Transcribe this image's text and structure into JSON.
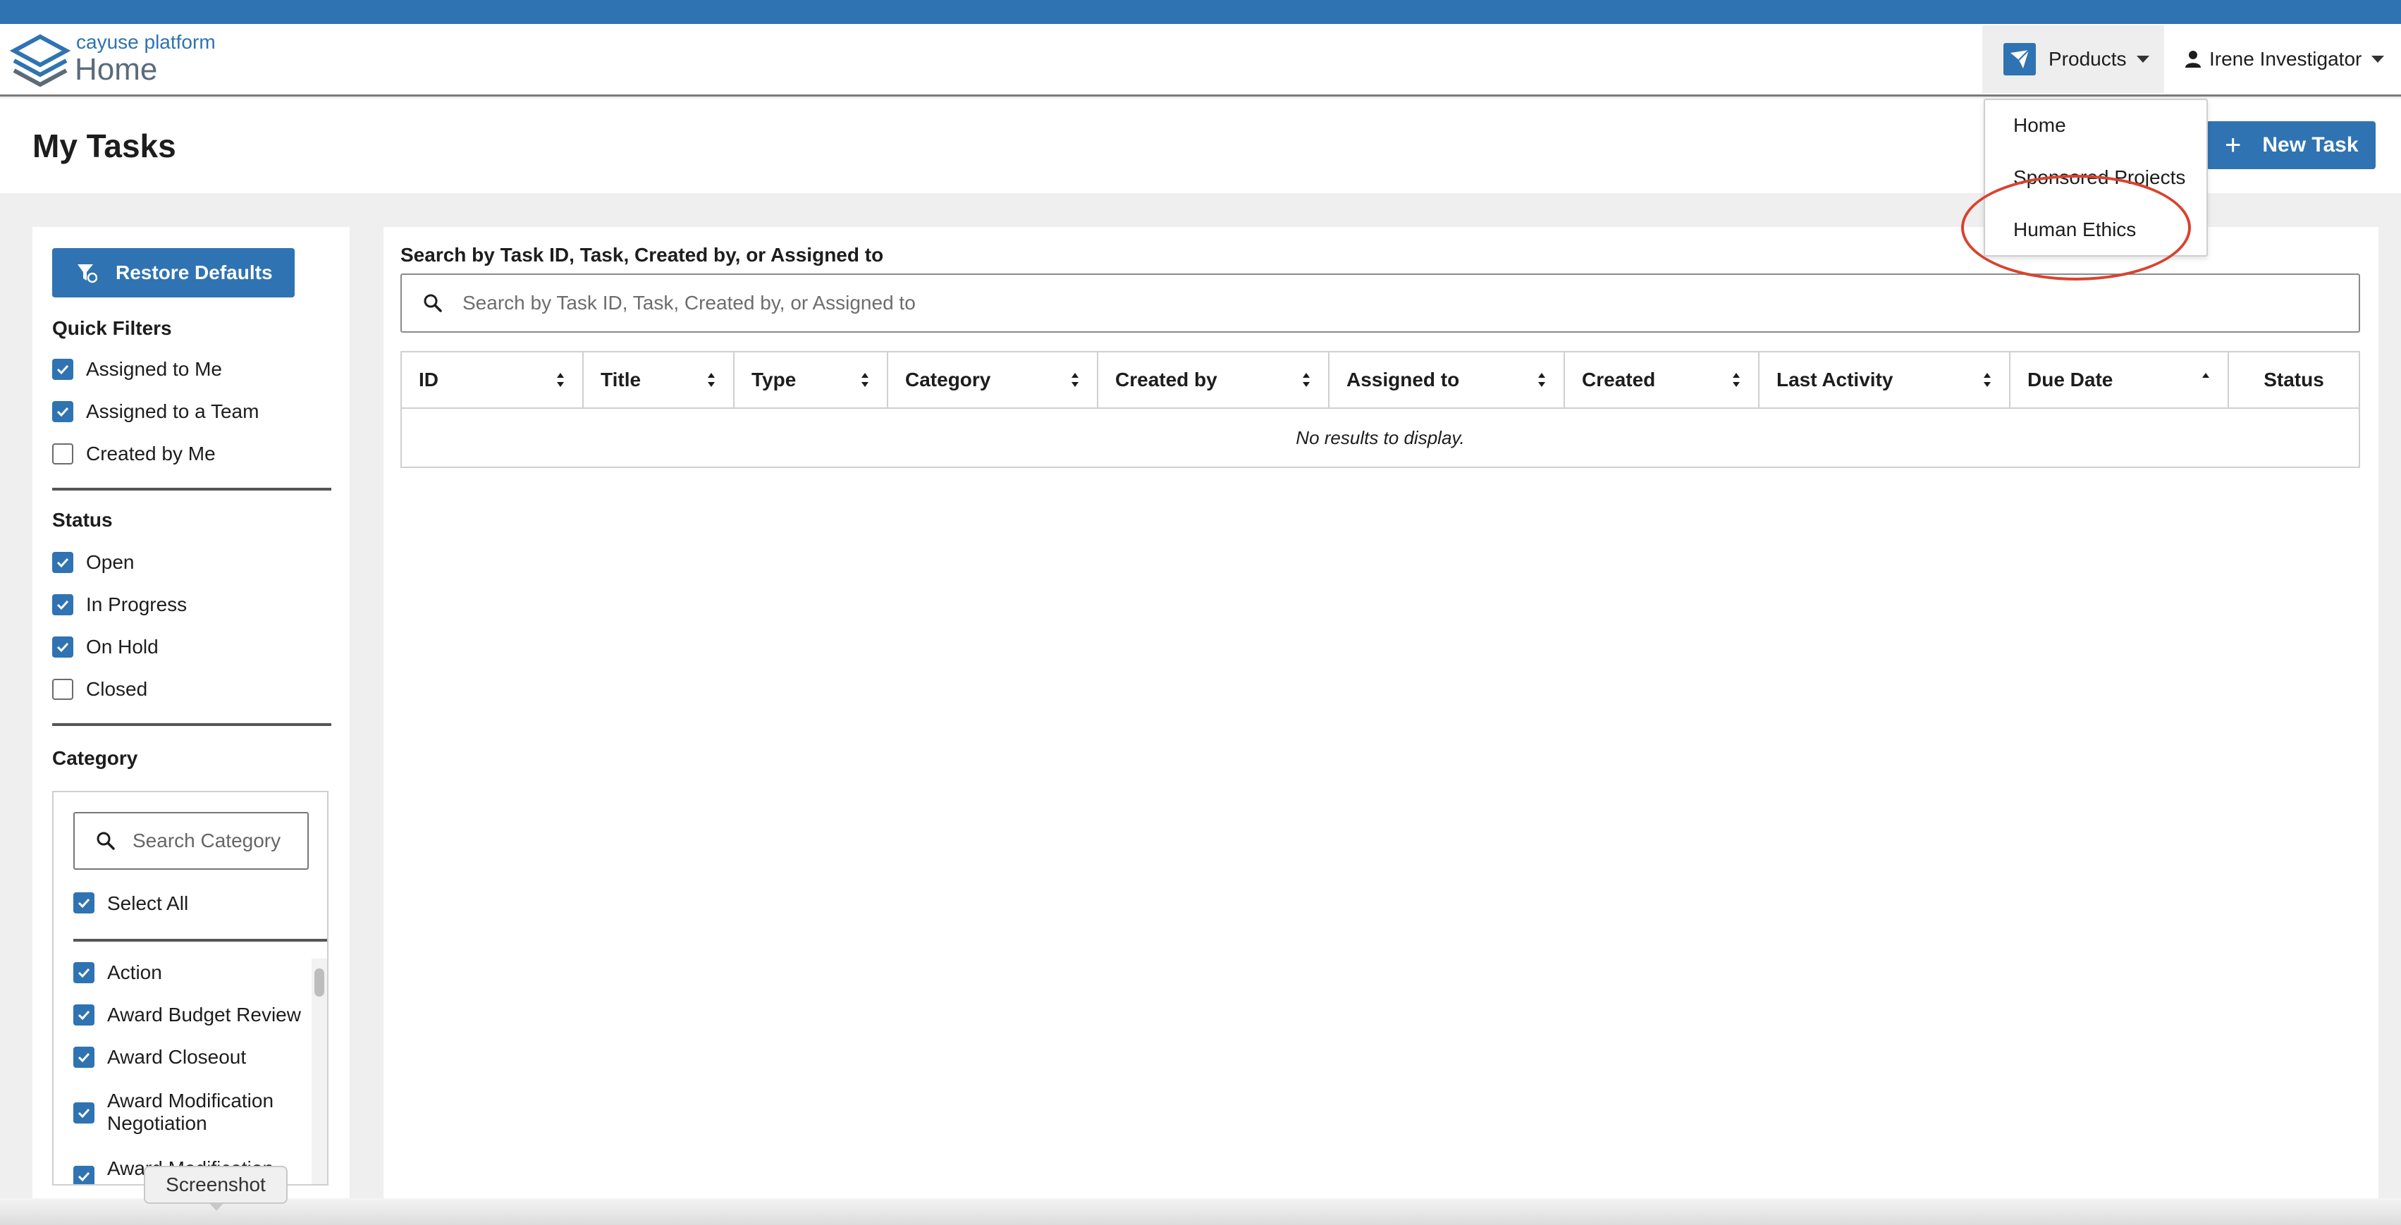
{
  "header": {
    "brand_top": "cayuse platform",
    "brand_bottom": "Home",
    "products_label": "Products",
    "user_name": "Irene Investigator"
  },
  "products_menu": {
    "items": [
      "Home",
      "Sponsored Projects",
      "Human Ethics"
    ],
    "highlighted_item": "Human Ethics"
  },
  "page": {
    "title": "My Tasks",
    "new_task_label": "New Task"
  },
  "sidebar": {
    "restore_label": "Restore Defaults",
    "quick_filters_title": "Quick Filters",
    "quick_filters": [
      {
        "label": "Assigned to Me",
        "checked": true
      },
      {
        "label": "Assigned to a Team",
        "checked": true
      },
      {
        "label": "Created by Me",
        "checked": false
      }
    ],
    "status_title": "Status",
    "statuses": [
      {
        "label": "Open",
        "checked": true
      },
      {
        "label": "In Progress",
        "checked": true
      },
      {
        "label": "On Hold",
        "checked": true
      },
      {
        "label": "Closed",
        "checked": false
      }
    ],
    "category_title": "Category",
    "category_search_placeholder": "Search Category",
    "select_all_label": "Select All",
    "categories": [
      {
        "label": "Action",
        "checked": true
      },
      {
        "label": "Award Budget Review",
        "checked": true
      },
      {
        "label": "Award Closeout",
        "checked": true
      },
      {
        "label": "Award Modification Negotiation",
        "checked": true
      },
      {
        "label": "Award Modification",
        "checked": true
      }
    ]
  },
  "main": {
    "search_label": "Search by Task ID, Task, Created by, or Assigned to",
    "search_placeholder": "Search by Task ID, Task, Created by, or Assigned to",
    "columns": [
      "ID",
      "Title",
      "Type",
      "Category",
      "Created by",
      "Assigned to",
      "Created",
      "Last Activity",
      "Due Date",
      "Status"
    ],
    "sorted_column": "Due Date",
    "empty_message": "No results to display."
  },
  "tooltip": {
    "label": "Screenshot"
  },
  "colors": {
    "accent": "#2f73b2",
    "highlight_ring": "#d9422f"
  }
}
